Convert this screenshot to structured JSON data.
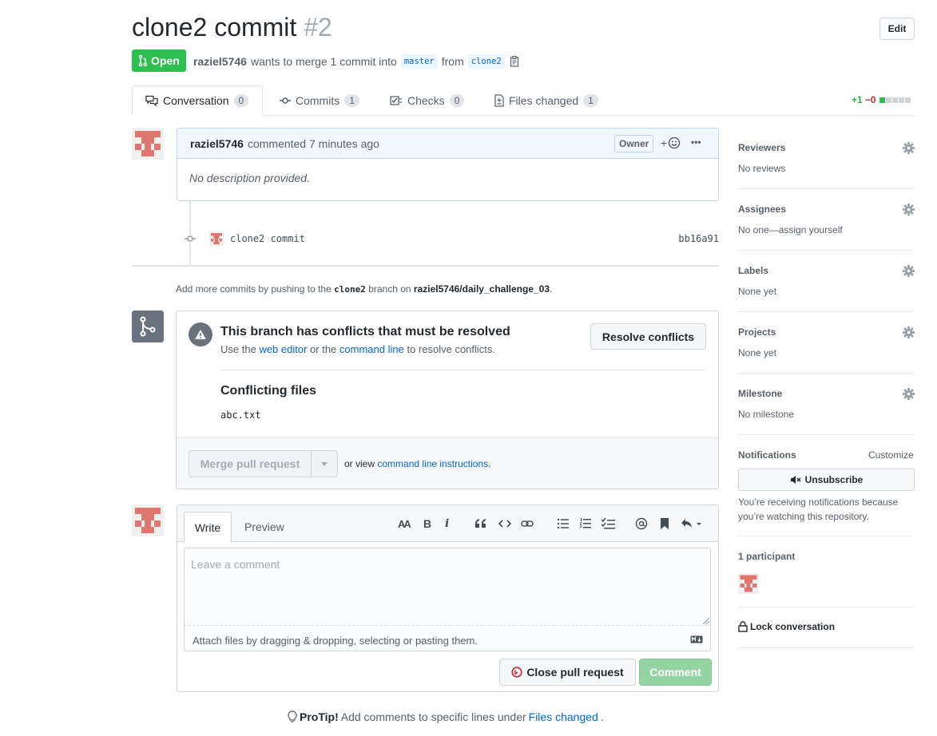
{
  "header": {
    "title": "clone2 commit",
    "number": "#2",
    "edit_label": "Edit",
    "state": "Open",
    "author": "raziel5746",
    "merge_text": "wants to merge 1 commit into",
    "base_branch": "master",
    "from_text": "from",
    "head_branch": "clone2"
  },
  "tabs": [
    {
      "label": "Conversation",
      "count": "0"
    },
    {
      "label": "Commits",
      "count": "1"
    },
    {
      "label": "Checks",
      "count": "0"
    },
    {
      "label": "Files changed",
      "count": "1"
    }
  ],
  "diffstat": {
    "added": "+1",
    "removed": "−0"
  },
  "comment": {
    "author": "raziel5746",
    "action": "commented 7 minutes ago",
    "badge": "Owner",
    "reaction": "+",
    "menu": "•••",
    "body": "No description provided."
  },
  "commit": {
    "message": "clone2 commit",
    "sha": "bb16a91"
  },
  "hint": {
    "pre": "Add more commits by pushing to the",
    "branch": "clone2",
    "mid": "branch on",
    "repo": "raziel5746/daily_challenge_03",
    "end": "."
  },
  "merge": {
    "conflict_title": "This branch has conflicts that must be resolved",
    "desc_pre": "Use the",
    "web_editor": "web editor",
    "desc_mid": "or the",
    "command_line": "command line",
    "desc_end": "to resolve conflicts.",
    "resolve_label": "Resolve conflicts",
    "conflicting_title": "Conflicting files",
    "file": "abc.txt",
    "merge_label": "Merge pull request",
    "or_view": "or view",
    "cli_link": "command line instructions",
    "period": "."
  },
  "new_comment": {
    "write_tab": "Write",
    "preview_tab": "Preview",
    "placeholder": "Leave a comment",
    "attach": "Attach files by dragging & dropping, selecting or pasting them.",
    "close_label": "Close pull request",
    "comment_label": "Comment"
  },
  "toolbar": {
    "heading": "AA",
    "bold": "B",
    "italic": "i"
  },
  "protip": {
    "label": "ProTip!",
    "text": "Add comments to specific lines under",
    "link": "Files changed",
    "end": "."
  },
  "sidebar": {
    "reviewers": {
      "head": "Reviewers",
      "value": "No reviews"
    },
    "assignees": {
      "head": "Assignees",
      "value": "No one—assign yourself"
    },
    "labels": {
      "head": "Labels",
      "value": "None yet"
    },
    "projects": {
      "head": "Projects",
      "value": "None yet"
    },
    "milestone": {
      "head": "Milestone",
      "value": "No milestone"
    },
    "notifications": {
      "head": "Notifications",
      "customize": "Customize",
      "button": "Unsubscribe",
      "text": "You’re receiving notifications because you’re watching this repository."
    },
    "participants": "1 participant",
    "lock": "Lock conversation"
  },
  "colors": {
    "open": "#2cbe4e",
    "link": "#0366d6",
    "added": "#28a745",
    "removed": "#cb2431",
    "avatar": "#e0776f"
  }
}
